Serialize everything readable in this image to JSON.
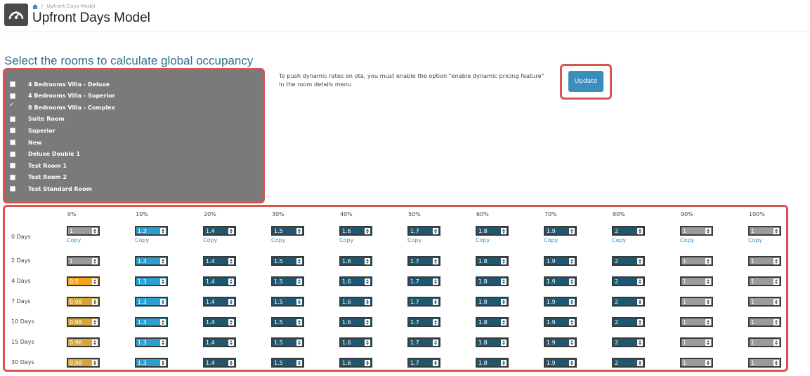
{
  "header": {
    "breadcrumb": "Upfront Days Model",
    "title": "Upfront Days Model"
  },
  "section_title": "Select the rooms to calculate global occupancy",
  "rooms": [
    {
      "label": "4 Bedrooms Villa - Deluxe",
      "checked": false
    },
    {
      "label": "4 Bedrooms Villa - Superior",
      "checked": false
    },
    {
      "label": "8 Bedrooms Villa - Complex",
      "checked": true
    },
    {
      "label": "Suite Room",
      "checked": false
    },
    {
      "label": "Superior",
      "checked": false
    },
    {
      "label": "New",
      "checked": false
    },
    {
      "label": "Deluxe Double 1",
      "checked": false
    },
    {
      "label": "Test Room 1",
      "checked": false
    },
    {
      "label": "Test Room 2",
      "checked": false
    },
    {
      "label": "Test Standard Room",
      "checked": false
    }
  ],
  "note": "To push dynamic rates on ota, you must enable the option \"enable dynamic pricing feature\" in the room details menu",
  "update_label": "Update",
  "copy_label": "Copy",
  "columns": [
    "0%",
    "10%",
    "20%",
    "30%",
    "40%",
    "50%",
    "60%",
    "70%",
    "80%",
    "90%",
    "100%"
  ],
  "rows": [
    {
      "label": "0 Days",
      "values": [
        "1",
        "1.3",
        "1.4",
        "1.5",
        "1.6",
        "1.7",
        "1.8",
        "1.9",
        "2",
        "1",
        "1"
      ]
    },
    {
      "label": "2 Days",
      "values": [
        "1",
        "1.3",
        "1.4",
        "1.5",
        "1.6",
        "1.7",
        "1.8",
        "1.9",
        "2",
        "1",
        "1"
      ]
    },
    {
      "label": "4 Days",
      "values": [
        "0.5",
        "1.3",
        "1.4",
        "1.5",
        "1.6",
        "1.7",
        "1.8",
        "1.9",
        "2",
        "1",
        "1"
      ]
    },
    {
      "label": "7 Days",
      "values": [
        "0.98",
        "1.3",
        "1.4",
        "1.5",
        "1.6",
        "1.7",
        "1.8",
        "1.9",
        "2",
        "1",
        "1"
      ]
    },
    {
      "label": "10 Days",
      "values": [
        "0.98",
        "1.3",
        "1.4",
        "1.5",
        "1.6",
        "1.7",
        "1.8",
        "1.9",
        "2",
        "1",
        "1"
      ]
    },
    {
      "label": "15 Days",
      "values": [
        "0.98",
        "1.3",
        "1.4",
        "1.5",
        "1.6",
        "1.7",
        "1.8",
        "1.9",
        "2",
        "1",
        "1"
      ]
    },
    {
      "label": "30 Days",
      "values": [
        "0.98",
        "1.3",
        "1.4",
        "1.5",
        "1.6",
        "1.7",
        "1.8",
        "1.9",
        "2",
        "1",
        "1"
      ]
    }
  ],
  "cell_colors": {
    "neutral": "#9b9b9b",
    "light_blue": "#2a9fd0",
    "dark_teal": "#1e5870",
    "orange": "#f4a51c",
    "gold": "#d7a33b",
    "highlight_border": "#d9534f"
  }
}
